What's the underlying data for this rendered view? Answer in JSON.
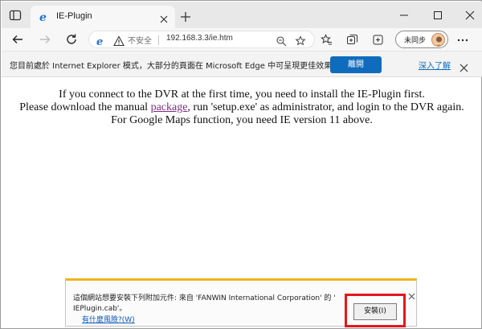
{
  "browser": {
    "tab": {
      "title": "IE-Plugin"
    },
    "address": {
      "security_label": "不安全",
      "url": "192.168.3.3/ie.htm"
    },
    "sync_label": "未同步"
  },
  "infobar": {
    "message": "您目前處於 Internet Explorer 模式，大部分的頁面在 Microsoft Edge 中可呈現更佳效果。",
    "leave_button": "離開",
    "learn_more": "深入了解"
  },
  "page": {
    "line1": "If you connect to the DVR at the first time, you need to install the IE-Plugin first.",
    "line2_before": "Please download the manual ",
    "line2_link": "package",
    "line2_after": ", run 'setup.exe' as administrator, and login to the DVR again.",
    "line3": "For Google Maps function, you need IE version 11 above."
  },
  "notification": {
    "text_line1": "這個網站想要安裝下列附加元件: 來自 'FANWIN International Corporation' 的 '",
    "text_line2": "IEPlugin.cab'。",
    "risk_link": "有什麼風險?(W)",
    "install_button": "安裝(I)"
  },
  "colors": {
    "accent_blue": "#0f6cbd",
    "notification_border": "#f0b520",
    "highlight_red": "#e4161b",
    "visited_link": "#7b2d7d"
  }
}
